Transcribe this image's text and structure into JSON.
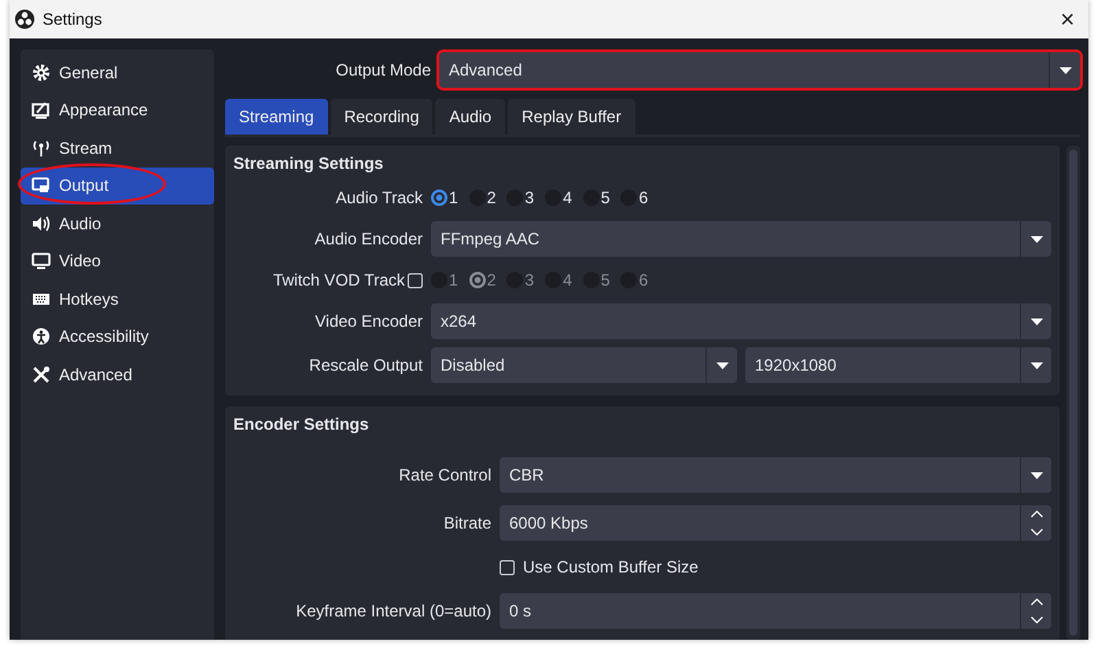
{
  "window": {
    "title": "Settings",
    "close": "×"
  },
  "sidebar": {
    "items": [
      {
        "label": "General",
        "selected": false,
        "highlighted": false
      },
      {
        "label": "Appearance",
        "selected": false,
        "highlighted": false
      },
      {
        "label": "Stream",
        "selected": false,
        "highlighted": false
      },
      {
        "label": "Output",
        "selected": true,
        "highlighted": true
      },
      {
        "label": "Audio",
        "selected": false,
        "highlighted": false
      },
      {
        "label": "Video",
        "selected": false,
        "highlighted": false
      },
      {
        "label": "Hotkeys",
        "selected": false,
        "highlighted": false
      },
      {
        "label": "Accessibility",
        "selected": false,
        "highlighted": false
      },
      {
        "label": "Advanced",
        "selected": false,
        "highlighted": false
      }
    ]
  },
  "output_mode": {
    "label": "Output Mode",
    "value": "Advanced",
    "highlighted": true
  },
  "tabs": [
    {
      "label": "Streaming",
      "selected": true
    },
    {
      "label": "Recording",
      "selected": false
    },
    {
      "label": "Audio",
      "selected": false
    },
    {
      "label": "Replay Buffer",
      "selected": false
    }
  ],
  "streaming_settings": {
    "title": "Streaming Settings",
    "rows": [
      {
        "kind": "radios",
        "label": "Audio Track",
        "disabled": false,
        "options": [
          {
            "label": "1",
            "selected": true
          },
          {
            "label": "2",
            "selected": false
          },
          {
            "label": "3",
            "selected": false
          },
          {
            "label": "4",
            "selected": false
          },
          {
            "label": "5",
            "selected": false
          },
          {
            "label": "6",
            "selected": false
          }
        ]
      },
      {
        "kind": "combo",
        "label": "Audio Encoder",
        "value": "FFmpeg AAC"
      },
      {
        "kind": "check-radios",
        "label": "Twitch VOD Track",
        "checked": false,
        "disabled": true,
        "options": [
          {
            "label": "1",
            "selected": false
          },
          {
            "label": "2",
            "selected": true
          },
          {
            "label": "3",
            "selected": false
          },
          {
            "label": "4",
            "selected": false
          },
          {
            "label": "5",
            "selected": false
          },
          {
            "label": "6",
            "selected": false
          }
        ]
      },
      {
        "kind": "combo",
        "label": "Video Encoder",
        "value": "x264"
      },
      {
        "kind": "combo-pair",
        "label": "Rescale Output",
        "values": [
          "Disabled",
          "1920x1080"
        ]
      }
    ]
  },
  "encoder_settings": {
    "title": "Encoder Settings",
    "rows": [
      {
        "kind": "combo",
        "label": "Rate Control",
        "value": "CBR"
      },
      {
        "kind": "spin",
        "label": "Bitrate",
        "value": "6000 Kbps"
      },
      {
        "kind": "checkbox",
        "label": "Use Custom Buffer Size",
        "checked": false
      },
      {
        "kind": "spin",
        "label": "Keyframe Interval (0=auto)",
        "value": "0 s"
      }
    ]
  }
}
